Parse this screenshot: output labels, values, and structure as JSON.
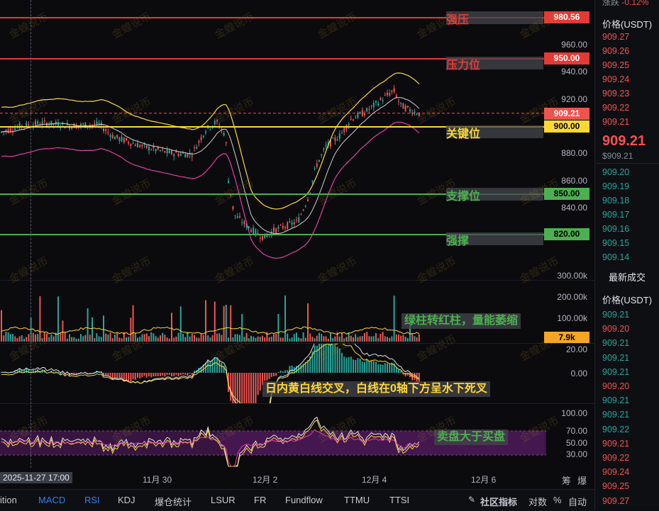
{
  "colors": {
    "red": "#e53935",
    "green": "#4caf50",
    "yellow": "#fdd835",
    "up": "#26a69a",
    "down": "#ef5350",
    "pink": "#e040fb",
    "white": "#d1d4dc",
    "orange": "#f5a623"
  },
  "main_axis": {
    "ticks": [
      "960.00",
      "940.00",
      "920.00",
      "880.00",
      "860.00",
      "840.00"
    ]
  },
  "volume_axis": {
    "ticks": [
      "300.00k",
      "200.00k",
      "100.00k"
    ],
    "current": "7.9k"
  },
  "macd_axis": {
    "ticks": [
      "20.00",
      "0.00"
    ]
  },
  "rsi_axis": {
    "ticks": [
      "100.00",
      "70.00",
      "50.00",
      "30.00"
    ]
  },
  "levels": [
    {
      "label": "强压",
      "price": "980.56",
      "color": "#e53935"
    },
    {
      "label": "压力位",
      "price": "950.00",
      "color": "#e53935"
    },
    {
      "label": "关键位",
      "price": "900.00",
      "color": "#fdd835"
    },
    {
      "label": "支撑位",
      "price": "850.00",
      "color": "#4caf50"
    },
    {
      "label": "强撑",
      "price": "820.00",
      "color": "#4caf50"
    }
  ],
  "last_price_tag": "909.21",
  "annotations": {
    "volume": "绿柱转红柱，量能萎缩",
    "macd": "日内黄白线交叉，白线在0轴下方呈水下死叉",
    "rsi": "卖盘大于买盘"
  },
  "watermark": "金蝗说币",
  "x_axis": {
    "crosshair_label": "2025-11-27 17:00",
    "labels": [
      "11月 30",
      "12月 2",
      "12月 4",
      "12月 6"
    ],
    "right_labels": [
      "筹",
      "爆"
    ]
  },
  "toolbar": {
    "items": [
      "ition",
      "MACD",
      "RSI",
      "KDJ",
      "爆仓统计",
      "LSUR",
      "FR",
      "Fundflow",
      "TTMU",
      "TTSI"
    ],
    "right": [
      "社区指标",
      "对数",
      "%",
      "自动"
    ]
  },
  "sidebar": {
    "change_label": "涨跌",
    "change_value": "-0.12%",
    "orderbook_header": "价格(USDT)",
    "asks": [
      "909.27",
      "909.26",
      "909.25",
      "909.24",
      "909.23",
      "909.22",
      "909.21"
    ],
    "last_price": "909.21",
    "last_price_sub": "$909.21",
    "bids": [
      "909.20",
      "909.19",
      "909.18",
      "909.17",
      "909.16",
      "909.15",
      "909.14"
    ],
    "trades_title": "最新成交",
    "trades_header": "价格(USDT)",
    "trades": [
      {
        "p": "909.21",
        "side": "buy"
      },
      {
        "p": "909.20",
        "side": "sell"
      },
      {
        "p": "909.21",
        "side": "buy"
      },
      {
        "p": "909.21",
        "side": "buy"
      },
      {
        "p": "909.21",
        "side": "buy"
      },
      {
        "p": "909.20",
        "side": "sell"
      },
      {
        "p": "909.21",
        "side": "buy"
      },
      {
        "p": "909.21",
        "side": "buy"
      },
      {
        "p": "909.22",
        "side": "buy"
      },
      {
        "p": "909.21",
        "side": "sell"
      },
      {
        "p": "909.22",
        "side": "sell"
      },
      {
        "p": "909.24",
        "side": "sell"
      },
      {
        "p": "909.25",
        "side": "sell"
      },
      {
        "p": "909.27",
        "side": "sell"
      }
    ]
  }
}
